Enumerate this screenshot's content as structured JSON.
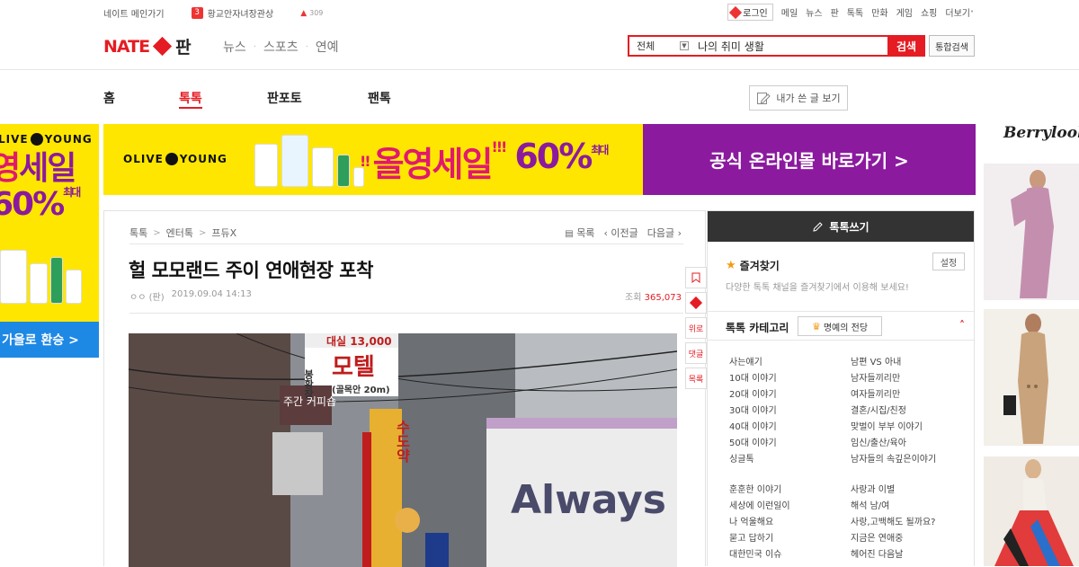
{
  "topbar": {
    "main_link": "네이트 메인가기",
    "rank_num": "3",
    "rank_text": "황교안자녀장관상",
    "hot_arrow": "▲",
    "hot_count": "309",
    "login": "로그인",
    "links": [
      "메일",
      "뉴스",
      "판",
      "톡톡",
      "만화",
      "게임",
      "쇼핑"
    ],
    "more": "더보기"
  },
  "header": {
    "logo_nate": "NATE",
    "logo_pan": "판",
    "nav": [
      "뉴스",
      "스포츠",
      "연예"
    ],
    "search_scope": "전체",
    "search_value": "나의 취미 생활",
    "search_button": "검색",
    "total_search": "통합검색"
  },
  "tabs": {
    "items": [
      "홈",
      "톡톡",
      "판포토",
      "팬톡"
    ],
    "active": "톡톡",
    "my_posts": "내가 쓴 글 보기"
  },
  "banner": {
    "brand_1": "OLIVE",
    "brand_2": "YOUNG",
    "exclaim": "!!",
    "sale_text": "올영세일",
    "sale_exclaim": "!!!",
    "percent": "60%",
    "max_label": "최대",
    "cta": "공식 온라인몰 바로가기 >"
  },
  "left_ad": {
    "brand_1": "LIVE",
    "brand_2": "YOUNG",
    "line1": "영",
    "line1b": "세일",
    "line2": "60%",
    "max_label": "최대",
    "cta": "가을로 환승 >"
  },
  "right_ad": {
    "brand": "Berrylook"
  },
  "article": {
    "breadcrumb": [
      "톡톡",
      "엔터톡",
      "프듀X"
    ],
    "nav_list": "목록",
    "nav_prev": "이전글",
    "nav_next": "다음글",
    "title": "헐 모모랜드 주이 연애현장 포착",
    "author": "ㅇㅇ",
    "author_tag": "(판)",
    "date": "2019.09.04 14:13",
    "views_label": "조회",
    "views": "365,073",
    "tools": [
      "위로",
      "댓글",
      "목록"
    ]
  },
  "photo": {
    "sign_top": "대실 13,000",
    "sign_motel": "모텔",
    "sign_left": "봉황장",
    "sign_sub": "(골목안 20m)",
    "sign_coffee": "주간 커피숍",
    "sign_vert": "수도약",
    "banner_text": "Always"
  },
  "sidebar": {
    "write": "톡톡쓰기",
    "fav_title": "즐겨찾기",
    "fav_set": "설정",
    "fav_desc": "다양한 톡톡 채널을 즐겨찾기에서 이용해 보세요!",
    "cat_title": "톡톡 카테고리",
    "hall": "명예의 전당",
    "group1": [
      "사는얘기",
      "남편 VS 아내",
      "10대 이야기",
      "남자들끼리만",
      "20대 이야기",
      "여자들끼리만",
      "30대 이야기",
      "결혼/시집/친정",
      "40대 이야기",
      "맞벌이 부부 이야기",
      "50대 이야기",
      "임신/출산/육아",
      "싱글톡",
      "남자들의 속깊은이야기"
    ],
    "group2": [
      "훈훈한 이야기",
      "사랑과 이별",
      "세상에 이런일이",
      "해석 남/여",
      "나 억울해요",
      "사랑,고백해도 될까요?",
      "묻고 답하기",
      "지금은 연애중",
      "대한민국 이슈",
      "헤어진 다음날"
    ]
  },
  "colors": {
    "brand_red": "#e51c23",
    "olive_yellow": "#ffe600",
    "olive_purple": "#8b1a9e"
  }
}
